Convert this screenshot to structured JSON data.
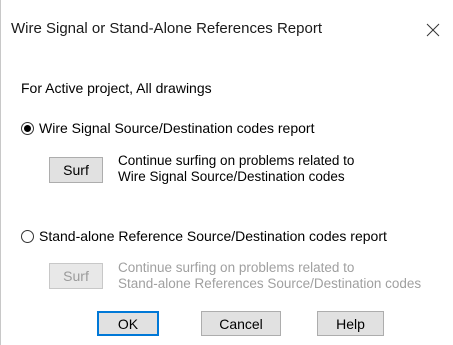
{
  "window": {
    "title": "Wire Signal or Stand-Alone References Report",
    "close_icon": "close-icon"
  },
  "scope": {
    "text": "For Active project, All drawings"
  },
  "options": [
    {
      "label": "Wire Signal Source/Destination codes report",
      "selected": true,
      "surf_label": "Surf",
      "surf_enabled": true,
      "description_line1": "Continue surfing on problems related to",
      "description_line2": "Wire Signal Source/Destination codes"
    },
    {
      "label": "Stand-alone Reference Source/Destination codes report",
      "selected": false,
      "surf_label": "Surf",
      "surf_enabled": false,
      "description_line1": "Continue surfing on problems related to",
      "description_line2": "Stand-alone References Source/Destination codes"
    }
  ],
  "buttons": {
    "ok": "OK",
    "cancel": "Cancel",
    "help": "Help"
  },
  "colors": {
    "default_button_border": "#0078d7",
    "disabled_text": "#a0a0a0"
  }
}
